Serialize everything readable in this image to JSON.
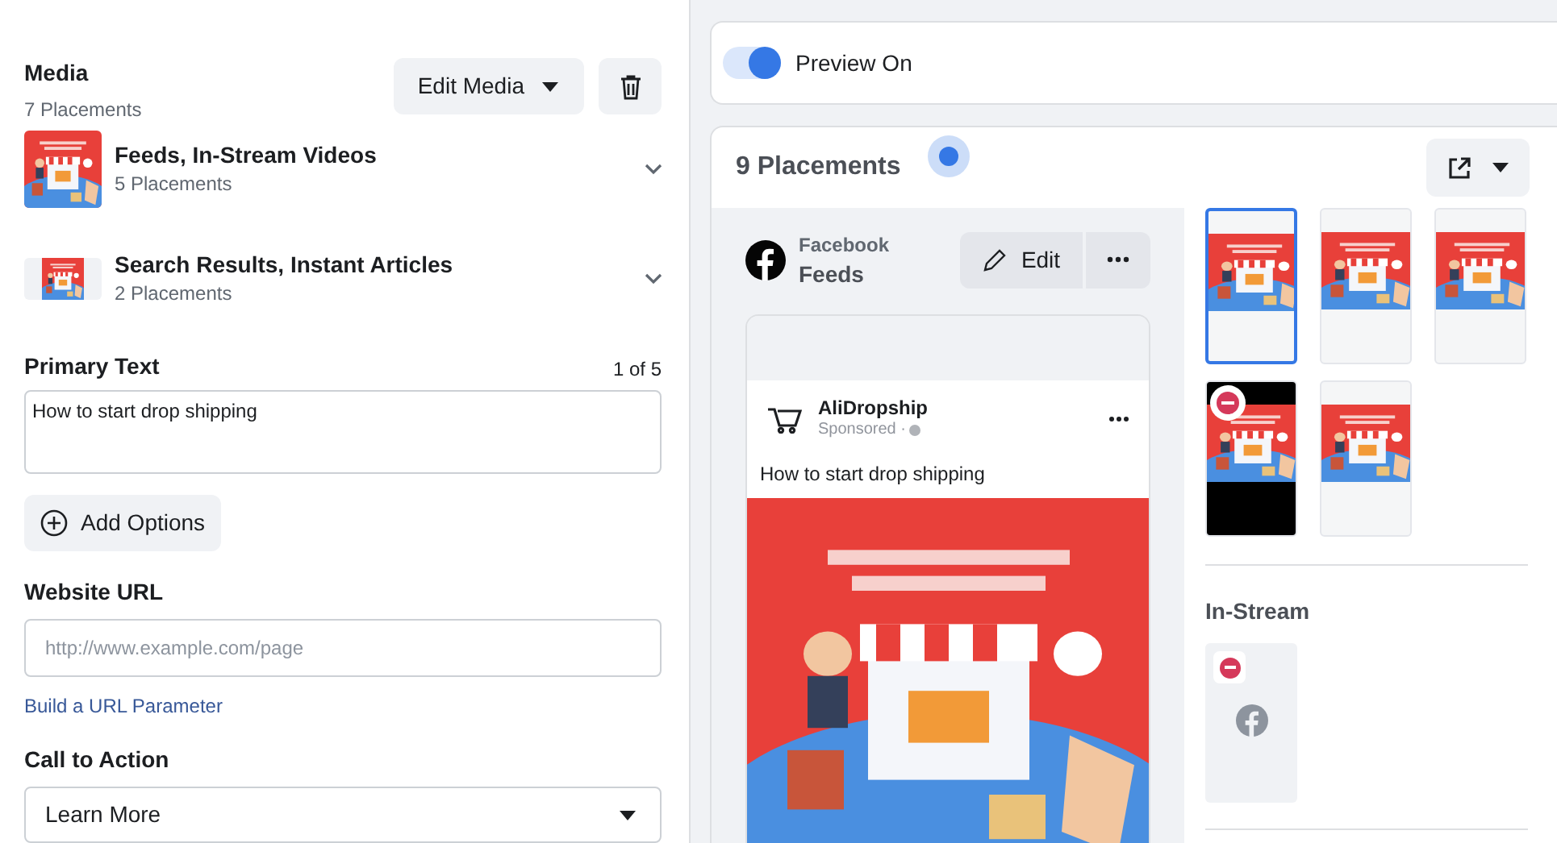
{
  "media": {
    "title": "Media",
    "subtitle": "7 Placements",
    "edit_button": "Edit Media",
    "groups": [
      {
        "title": "Feeds, In-Stream Videos",
        "subtitle": "5 Placements",
        "expanded": false,
        "kind": "square"
      },
      {
        "title": "Search Results, Instant Articles",
        "subtitle": "2 Placements",
        "expanded": false,
        "kind": "wide"
      }
    ]
  },
  "primary_text": {
    "label": "Primary Text",
    "counter": "1 of 5",
    "value": "How to start drop shipping"
  },
  "add_options": "Add Options",
  "website_url": {
    "label": "Website URL",
    "placeholder": "http://www.example.com/page",
    "link": "Build a URL Parameter"
  },
  "call_to_action": {
    "label": "Call to Action",
    "value": "Learn More"
  },
  "preview": {
    "label": "Preview On",
    "on": true
  },
  "placements": {
    "title": "9 Placements",
    "current": {
      "platform": "Facebook",
      "placement": "Feeds",
      "edit": "Edit"
    },
    "ad": {
      "page": "AliDropship",
      "sponsored": "Sponsored ·",
      "text": "How to start drop shipping"
    },
    "thumbnails": [
      {
        "kind": "light",
        "selected": true,
        "disabled": false
      },
      {
        "kind": "light",
        "selected": false,
        "disabled": false
      },
      {
        "kind": "light",
        "selected": false,
        "disabled": false
      },
      {
        "kind": "dark",
        "selected": false,
        "disabled": true
      },
      {
        "kind": "light",
        "selected": false,
        "disabled": false
      }
    ],
    "in_stream": {
      "title": "In-Stream",
      "disabled": true
    }
  }
}
